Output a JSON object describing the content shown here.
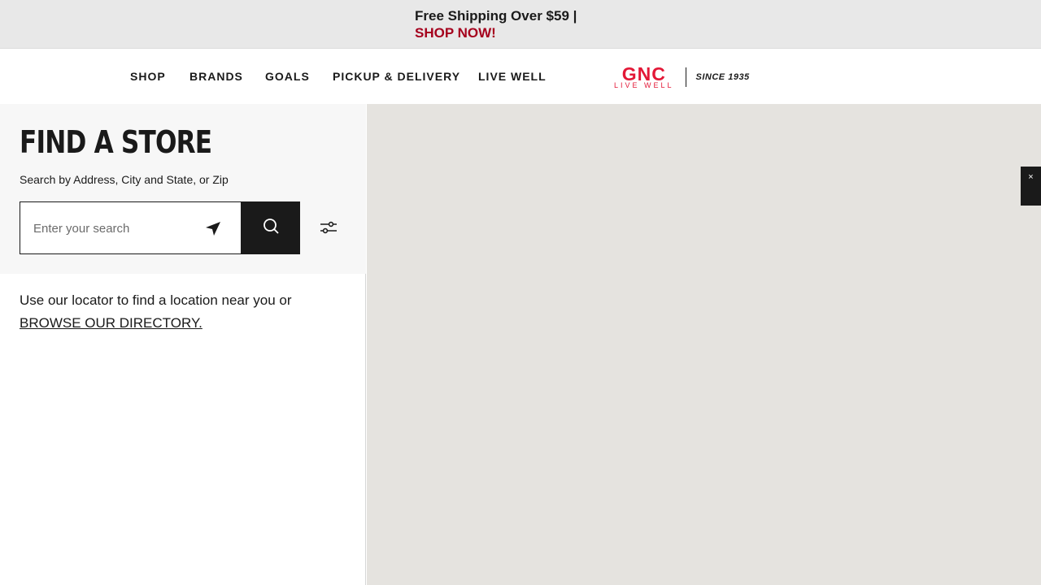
{
  "promo": {
    "line1": "Free Shipping Over $59 |",
    "link": "SHOP NOW!"
  },
  "nav": {
    "items": [
      {
        "label": "SHOP"
      },
      {
        "label": "BRANDS"
      },
      {
        "label": "GOALS"
      },
      {
        "label": "PICKUP & DELIVERY"
      },
      {
        "label": "LIVE WELL"
      }
    ]
  },
  "logo": {
    "brand": "GNC",
    "tagline": "LIVE WELL",
    "since": "SINCE 1935"
  },
  "store_finder": {
    "title": "FIND A STORE",
    "hint": "Search by Address, City and State, or Zip",
    "search_placeholder": "Enter your search",
    "locator_text": "Use our locator to find a location near you or",
    "directory_link": "BROWSE OUR DIRECTORY."
  },
  "map": {
    "close_label": "×"
  },
  "colors": {
    "brand_red": "#e31837",
    "promo_red": "#a5001d",
    "map_bg": "#e5e3df"
  }
}
